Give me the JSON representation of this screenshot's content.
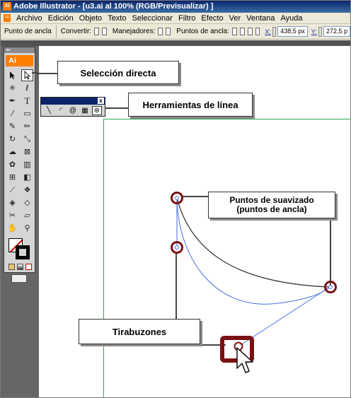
{
  "window": {
    "title": "Adobe Illustrator - [u3.ai al 100% (RGB/Previsualizar) ]",
    "app_icon": "Ai"
  },
  "menu": {
    "items": [
      "Archivo",
      "Edición",
      "Objeto",
      "Texto",
      "Seleccionar",
      "Filtro",
      "Efecto",
      "Ver",
      "Ventana",
      "Ayuda"
    ]
  },
  "control_bar": {
    "context_label": "Punto de ancla",
    "convert_label": "Convertir:",
    "handles_label": "Manejadores:",
    "anchor_points_label": "Puntos de ancla:",
    "x_label": "X:",
    "x_value": "438,5 px",
    "y_label": "Y:",
    "y_value": "272,5 p"
  },
  "toolbox": {
    "logo": "Ai",
    "tools": [
      "selection-tool-icon",
      "direct-selection-tool-icon",
      "magic-wand-tool-icon",
      "lasso-tool-icon",
      "pen-tool-icon",
      "type-tool-icon",
      "line-tool-icon",
      "rectangle-tool-icon",
      "paintbrush-tool-icon",
      "pencil-tool-icon",
      "rotate-tool-icon",
      "scale-tool-icon",
      "warp-tool-icon",
      "free-transform-tool-icon",
      "symbol-sprayer-tool-icon",
      "graph-tool-icon",
      "mesh-tool-icon",
      "gradient-tool-icon",
      "eyedropper-tool-icon",
      "blend-tool-icon",
      "live-paint-tool-icon",
      "live-paint-selection-tool-icon",
      "slice-tool-icon",
      "eraser-tool-icon",
      "hand-tool-icon",
      "zoom-tool-icon"
    ]
  },
  "line_tools_panel": {
    "tools": [
      "line-segment-tool-icon",
      "arc-tool-icon",
      "spiral-tool-icon",
      "rectangular-grid-tool-icon",
      "polar-grid-tool-icon"
    ]
  },
  "callouts": {
    "direct_selection": "Selección directa",
    "line_tools": "Herramientas de línea",
    "smooth_points_line1": "Puntos de suavizado",
    "smooth_points_line2": "(puntos de ancla)",
    "handles": "Tirabuzones"
  },
  "colors": {
    "accent_orange": "#ff7d00",
    "artboard_guide": "#2fa84f",
    "anchor_highlight": "#7a1111",
    "path_stroke": "#333333",
    "handle_line": "#4a6fe3"
  }
}
